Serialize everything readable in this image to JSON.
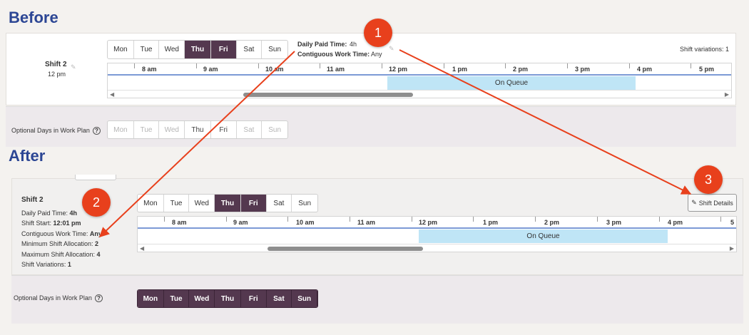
{
  "headings": {
    "before": "Before",
    "after": "After"
  },
  "days": [
    "Mon",
    "Tue",
    "Wed",
    "Thu",
    "Fri",
    "Sat",
    "Sun"
  ],
  "before": {
    "shift_name": "Shift 2",
    "shift_time": "12 pm",
    "daily_paid_label": "Daily Paid Time:",
    "daily_paid_value": "4h",
    "contiguous_label": "Contiguous Work Time:",
    "contiguous_value": "Any",
    "shift_variations": "Shift variations: 1",
    "hours": [
      "8 am",
      "9 am",
      "10 am",
      "11 am",
      "12 pm",
      "1 pm",
      "2 pm",
      "3 pm",
      "4 pm",
      "5 pm"
    ],
    "on_queue": "On Queue",
    "optional_label": "Optional Days in Work Plan"
  },
  "after": {
    "shift_name": "Shift 2",
    "details": [
      {
        "label": "Daily Paid Time: ",
        "value": "4h"
      },
      {
        "label": "Shift Start: ",
        "value": "12:01 pm"
      },
      {
        "label": "Contiguous Work Time: ",
        "value": "Any"
      },
      {
        "label": "Minimum Shift Allocation: ",
        "value": "2"
      },
      {
        "label": "Maximum Shift Allocation: ",
        "value": "4"
      },
      {
        "label": "Shift Variations: ",
        "value": "1"
      }
    ],
    "hours": [
      "8 am",
      "9 am",
      "10 am",
      "11 am",
      "12 pm",
      "1 pm",
      "2 pm",
      "3 pm",
      "4 pm",
      "5"
    ],
    "on_queue": "On Queue",
    "shift_details_button": "Shift Details",
    "optional_label": "Optional Days in Work Plan"
  },
  "badges": [
    "1",
    "2",
    "3"
  ],
  "colors": {
    "heading": "#2c4694",
    "selected_day": "#54384f",
    "on_queue": "#bfe5f6",
    "arrow": "#e8401c"
  }
}
